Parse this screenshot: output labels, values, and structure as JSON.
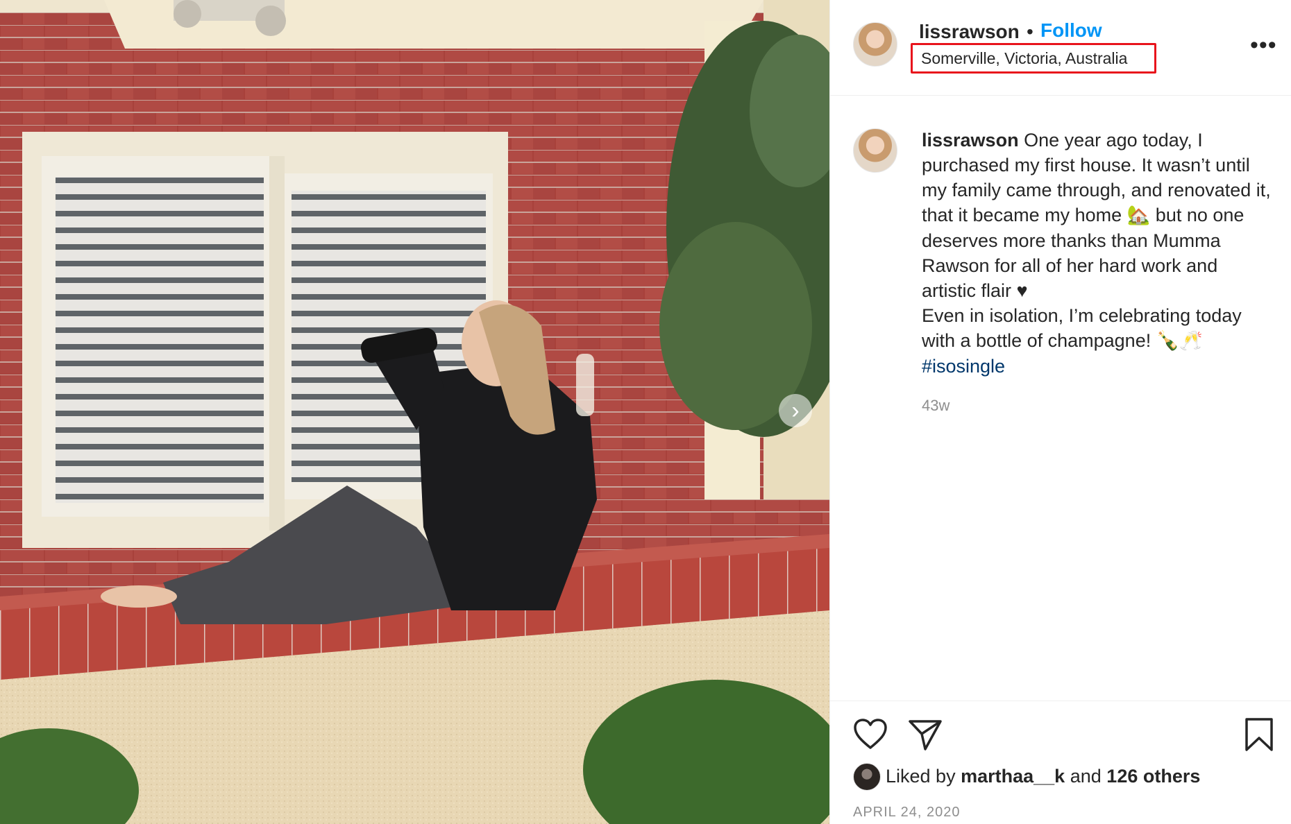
{
  "post": {
    "username": "lissrawson",
    "separator": "•",
    "follow_label": "Follow",
    "location": "Somerville, Victoria, Australia",
    "more_label": "•••",
    "caption": {
      "username": "lissrawson",
      "line1": "One year ago today, I purchased my first house. It wasn’t until my family came through, and renovated it, that it became my home",
      "house_emoji": "🏡",
      "line2": "but no one deserves more thanks than Mumma Rawson for all of her hard work and artistic flair",
      "heart": "♥",
      "line3": "Even in isolation, I’m celebrating today with a bottle of champagne!",
      "champagne_emoji": "🍾🥂",
      "hashtag": "#isosingle"
    },
    "time_ago": "43w",
    "likes": {
      "prefix": "Liked by",
      "user": "marthaa__k",
      "conjunction": "and",
      "others": "126 others"
    },
    "date": "APRIL 24, 2020"
  },
  "media": {
    "next_icon": "chevron-right-icon",
    "next_glyph": "›"
  },
  "icons": {
    "like": "heart-outline-icon",
    "share": "paper-plane-icon",
    "save": "bookmark-icon",
    "more": "ellipsis-icon"
  }
}
